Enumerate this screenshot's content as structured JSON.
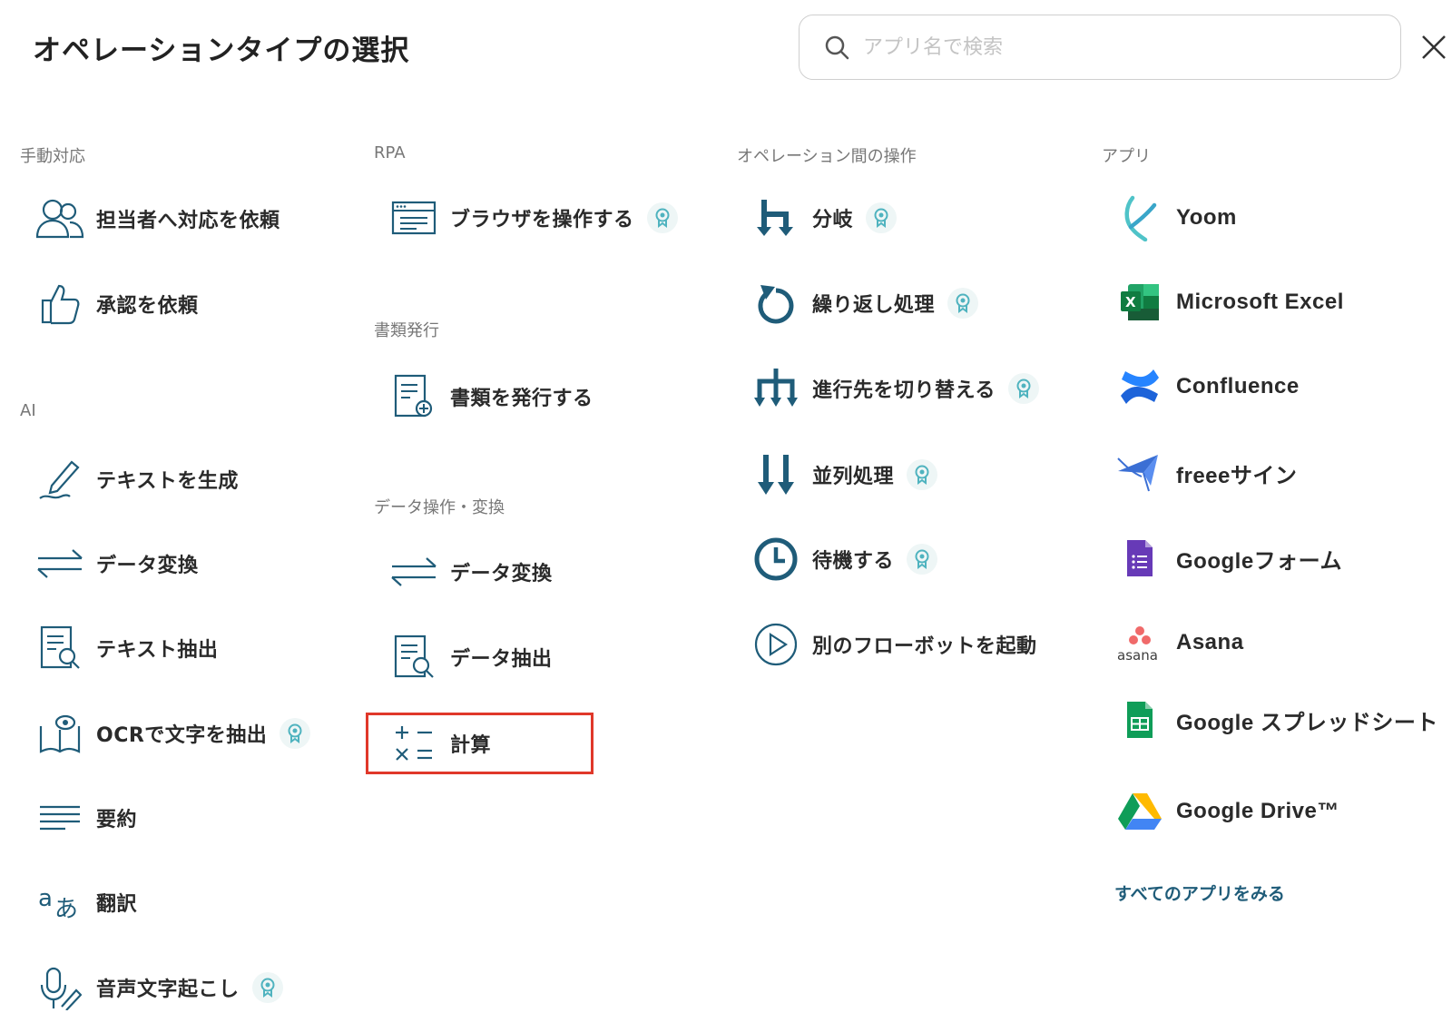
{
  "header": {
    "title": "オペレーションタイプの選択"
  },
  "search": {
    "placeholder": "アプリ名で検索"
  },
  "sections": {
    "manual": {
      "label": "手動対応",
      "items": [
        "担当者へ対応を依頼",
        "承認を依頼"
      ]
    },
    "ai": {
      "label": "AI",
      "items": [
        "テキストを生成",
        "データ変換",
        "テキスト抽出",
        "OCRで文字を抽出",
        "要約",
        "翻訳",
        "音声文字起こし"
      ]
    },
    "rpa": {
      "label": "RPA",
      "items": [
        "ブラウザを操作する"
      ]
    },
    "docs": {
      "label": "書類発行",
      "items": [
        "書類を発行する"
      ]
    },
    "data_ops": {
      "label": "データ操作・変換",
      "items": [
        "データ変換",
        "データ抽出",
        "計算"
      ]
    },
    "between_ops": {
      "label": "オペレーション間の操作",
      "items": [
        "分岐",
        "繰り返し処理",
        "進行先を切り替える",
        "並列処理",
        "待機する",
        "別のフローボットを起動"
      ]
    },
    "apps": {
      "label": "アプリ",
      "items": [
        "Yoom",
        "Microsoft Excel",
        "Confluence",
        "freeeサイン",
        "Googleフォーム",
        "Asana",
        "Google スプレッドシート",
        "Google Drive™"
      ],
      "more_link": "すべてのアプリをみる",
      "asana_logo_text": "asana"
    }
  },
  "colors": {
    "icon": "#1f5c79",
    "highlight": "#e0382a",
    "badge_bg": "#eef6f6",
    "badge_icon": "#4fb3bf"
  }
}
